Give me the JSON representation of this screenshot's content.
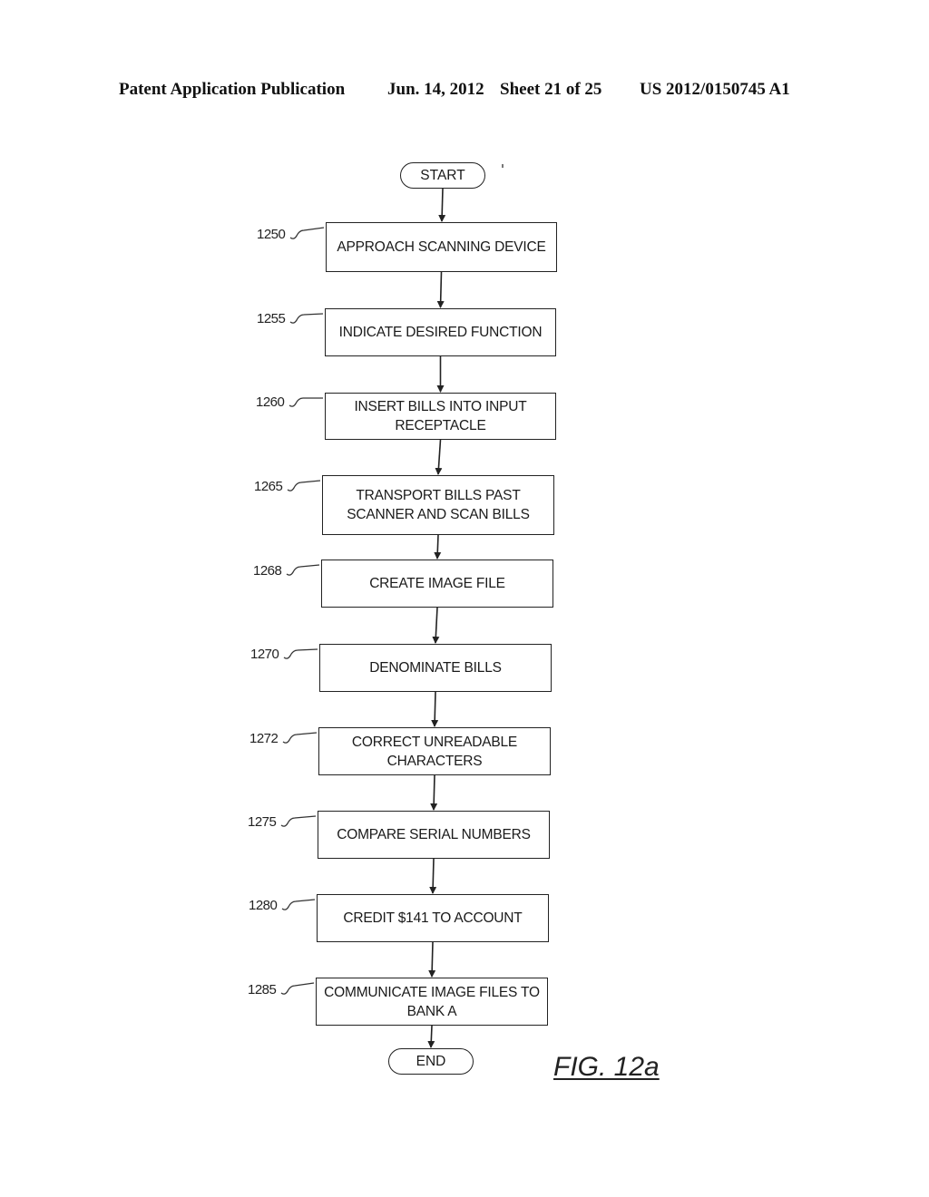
{
  "header": {
    "publication": "Patent Application Publication",
    "date": "Jun. 14, 2012",
    "sheet": "Sheet 21 of 25",
    "number": "US 2012/0150745 A1"
  },
  "flowchart": {
    "start_label": "START",
    "end_label": "END",
    "steps": [
      {
        "ref": "1250",
        "text": "APPROACH SCANNING DEVICE"
      },
      {
        "ref": "1255",
        "text": "INDICATE DESIRED FUNCTION"
      },
      {
        "ref": "1260",
        "text": "INSERT BILLS INTO INPUT\nRECEPTACLE"
      },
      {
        "ref": "1265",
        "text": "TRANSPORT BILLS PAST\nSCANNER AND SCAN BILLS"
      },
      {
        "ref": "1268",
        "text": "CREATE IMAGE FILE"
      },
      {
        "ref": "1270",
        "text": "DENOMINATE BILLS"
      },
      {
        "ref": "1272",
        "text": "CORRECT UNREADABLE\nCHARACTERS"
      },
      {
        "ref": "1275",
        "text": "COMPARE SERIAL NUMBERS"
      },
      {
        "ref": "1280",
        "text": "CREDIT $141 TO ACCOUNT"
      },
      {
        "ref": "1285",
        "text": "COMMUNICATE IMAGE FILES TO\nBANK A"
      }
    ]
  },
  "figure_label": "FIG. 12a"
}
